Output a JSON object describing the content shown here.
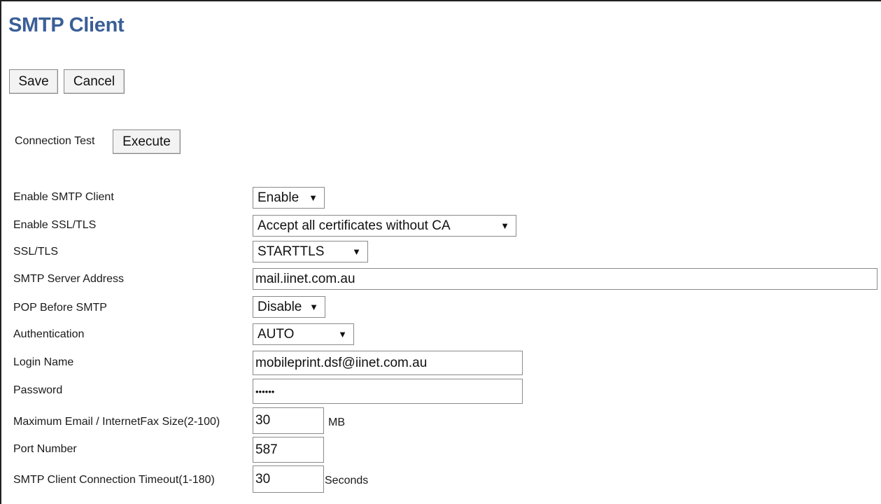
{
  "page": {
    "title": "SMTP Client"
  },
  "toolbar": {
    "save_label": "Save",
    "cancel_label": "Cancel"
  },
  "connection_test": {
    "label": "Connection Test",
    "button_label": "Execute"
  },
  "fields": {
    "enable_smtp_client": {
      "label": "Enable SMTP Client",
      "value": "Enable"
    },
    "enable_ssl_tls": {
      "label": "Enable SSL/TLS",
      "value": "Accept all certificates without CA"
    },
    "ssl_tls": {
      "label": "SSL/TLS",
      "value": "STARTTLS"
    },
    "smtp_server_address": {
      "label": "SMTP Server Address",
      "value": "mail.iinet.com.au"
    },
    "pop_before_smtp": {
      "label": "POP Before SMTP",
      "value": "Disable"
    },
    "authentication": {
      "label": "Authentication",
      "value": "AUTO"
    },
    "login_name": {
      "label": "Login Name",
      "value": "mobileprint.dsf@iinet.com.au"
    },
    "password": {
      "label": "Password",
      "value": "••••••"
    },
    "max_email_size": {
      "label": "Maximum Email / InternetFax Size(2-100)",
      "value": "30",
      "unit": "MB"
    },
    "port_number": {
      "label": "Port Number",
      "value": "587"
    },
    "connection_timeout": {
      "label": "SMTP Client Connection Timeout(1-180)",
      "value": "30",
      "unit": "Seconds"
    }
  },
  "icons": {
    "dropdown_arrow": "▼"
  }
}
